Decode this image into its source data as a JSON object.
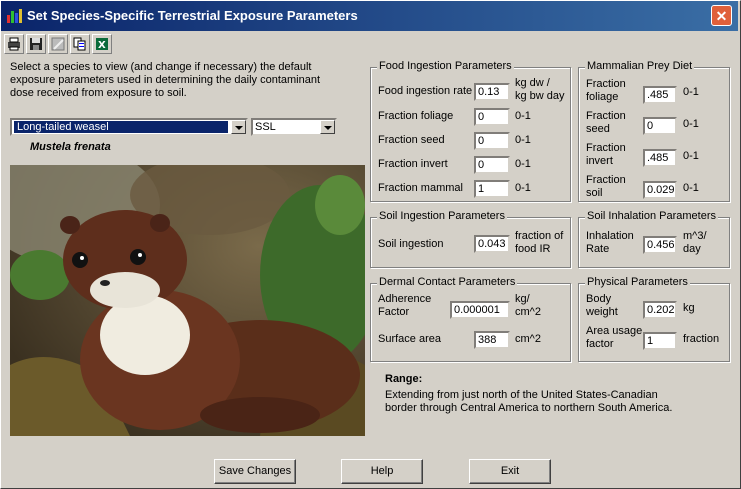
{
  "window": {
    "title": "Set Species-Specific Terrestrial Exposure Parameters"
  },
  "toolbar": {
    "icons": [
      "print-icon",
      "save-icon",
      "edit-icon",
      "copy-icon",
      "excel-icon"
    ]
  },
  "intro": "Select a species to view (and change if necessary) the default exposure parameters used in determining the daily contaminant dose received from exposure to soil.",
  "species": {
    "selected": "Long-tailed weasel",
    "scientific": "Mustela frenata"
  },
  "screening": {
    "selected": "SSL"
  },
  "food": {
    "legend": "Food Ingestion Parameters",
    "ingestion_label": "Food ingestion rate",
    "ingestion_value": "0.13",
    "ingestion_unit1": "kg dw /",
    "ingestion_unit2": "kg bw day",
    "foliage_label": "Fraction foliage",
    "foliage_value": "0",
    "foliage_unit": "0-1",
    "seed_label": "Fraction seed",
    "seed_value": "0",
    "seed_unit": "0-1",
    "invert_label": "Fraction invert",
    "invert_value": "0",
    "invert_unit": "0-1",
    "mammal_label": "Fraction mammal",
    "mammal_value": "1",
    "mammal_unit": "0-1"
  },
  "prey": {
    "legend": "Mammalian Prey Diet",
    "foliage_l1": "Fraction",
    "foliage_l2": "foliage",
    "foliage_value": ".485",
    "foliage_unit": "0-1",
    "seed_l1": "Fraction",
    "seed_l2": "seed",
    "seed_value": "0",
    "seed_unit": "0-1",
    "invert_l1": "Fraction",
    "invert_l2": "invert",
    "invert_value": ".485",
    "invert_unit": "0-1",
    "soil_l1": "Fraction",
    "soil_l2": "soil",
    "soil_value": "0.029",
    "soil_unit": "0-1"
  },
  "soil_ing": {
    "legend": "Soil Ingestion Parameters",
    "label": "Soil ingestion",
    "value": "0.043",
    "unit1": "fraction of",
    "unit2": "food IR"
  },
  "soil_inh": {
    "legend": "Soil Inhalation Parameters",
    "l1": "Inhalation",
    "l2": "Rate",
    "value": "0.456",
    "unit1": "m^3/",
    "unit2": "day"
  },
  "dermal": {
    "legend": "Dermal Contact Parameters",
    "adh_l1": "Adherence",
    "adh_l2": "Factor",
    "adh_value": "0.000001",
    "adh_unit1": "kg/",
    "adh_unit2": "cm^2",
    "area_label": "Surface area",
    "area_value": "388",
    "area_unit": "cm^2"
  },
  "physical": {
    "legend": "Physical Parameters",
    "bw_l1": "Body",
    "bw_l2": "weight",
    "bw_value": "0.202",
    "bw_unit": "kg",
    "auf_l1": "Area usage",
    "auf_l2": "factor",
    "auf_value": "1",
    "auf_unit": "fraction"
  },
  "range": {
    "title": "Range:",
    "text": "Extending from just north of the United States-Canadian border through Central America to northern South America."
  },
  "buttons": {
    "save": "Save Changes",
    "help": "Help",
    "exit": "Exit"
  }
}
